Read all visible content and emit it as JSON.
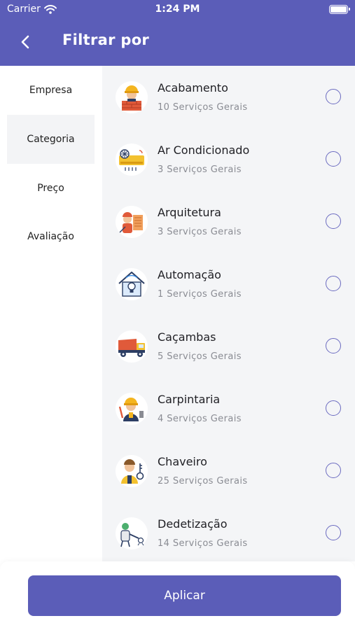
{
  "status_bar": {
    "carrier": "Carrier",
    "time": "1:24 PM"
  },
  "header": {
    "title": "Filtrar por"
  },
  "sidebar": {
    "items": [
      {
        "label": "Empresa"
      },
      {
        "label": "Categoria"
      },
      {
        "label": "Preço"
      },
      {
        "label": "Avaliação"
      }
    ],
    "active_item": "Categoria"
  },
  "categories": [
    {
      "name": "Acabamento",
      "subtitle": "10 Serviços Gerais",
      "icon": "builder-icon"
    },
    {
      "name": "Ar Condicionado",
      "subtitle": "3 Serviços Gerais",
      "icon": "air-conditioner-icon"
    },
    {
      "name": "Arquitetura",
      "subtitle": "3 Serviços Gerais",
      "icon": "architect-icon"
    },
    {
      "name": "Automação",
      "subtitle": "1 Serviços Gerais",
      "icon": "smart-home-icon"
    },
    {
      "name": "Caçambas",
      "subtitle": "5 Serviços Gerais",
      "icon": "dump-truck-icon"
    },
    {
      "name": "Carpintaria",
      "subtitle": "4 Serviços Gerais",
      "icon": "carpenter-icon"
    },
    {
      "name": "Chaveiro",
      "subtitle": "25 Serviços Gerais",
      "icon": "locksmith-icon"
    },
    {
      "name": "Dedetização",
      "subtitle": "14 Serviços Gerais",
      "icon": "pest-control-icon"
    }
  ],
  "footer": {
    "apply_label": "Aplicar"
  },
  "colors": {
    "primary": "#5b5db8",
    "panel": "#f4f5f7",
    "radio": "#6b6bc0"
  }
}
